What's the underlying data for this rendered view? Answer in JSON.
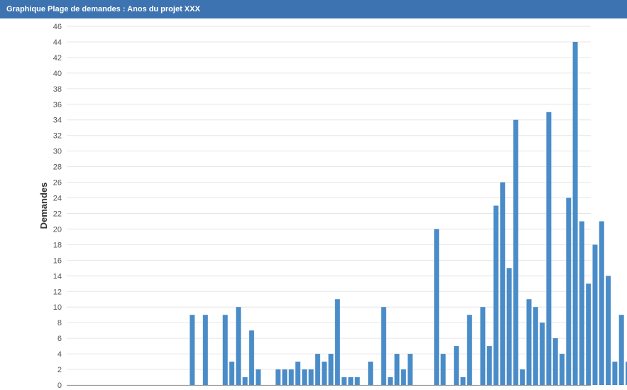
{
  "window": {
    "title": "Graphique Plage de demandes : Anos du projet XXX"
  },
  "colors": {
    "bar": "#4a8cc8",
    "titlebar": "#3d73b0",
    "grid": "#e6e6e6",
    "axis": "#999999"
  },
  "chart_data": {
    "type": "bar",
    "title": "",
    "ylabel": "Demandes",
    "xlabel": "",
    "ylim": [
      0,
      46
    ],
    "ytick_step": 2,
    "grid": true,
    "values": [
      0,
      0,
      0,
      0,
      0,
      0,
      0,
      0,
      0,
      9,
      0,
      9,
      0,
      0,
      9,
      3,
      10,
      1,
      7,
      2,
      0,
      0,
      2,
      2,
      2,
      3,
      2,
      2,
      4,
      3,
      4,
      11,
      1,
      1,
      1,
      0,
      3,
      0,
      10,
      1,
      4,
      2,
      4,
      0,
      0,
      0,
      20,
      4,
      0,
      5,
      1,
      9,
      0,
      10,
      5,
      23,
      26,
      15,
      34,
      2,
      11,
      10,
      8,
      35,
      6,
      4,
      24,
      44,
      21,
      13,
      18,
      21,
      14,
      3,
      9,
      3
    ]
  }
}
